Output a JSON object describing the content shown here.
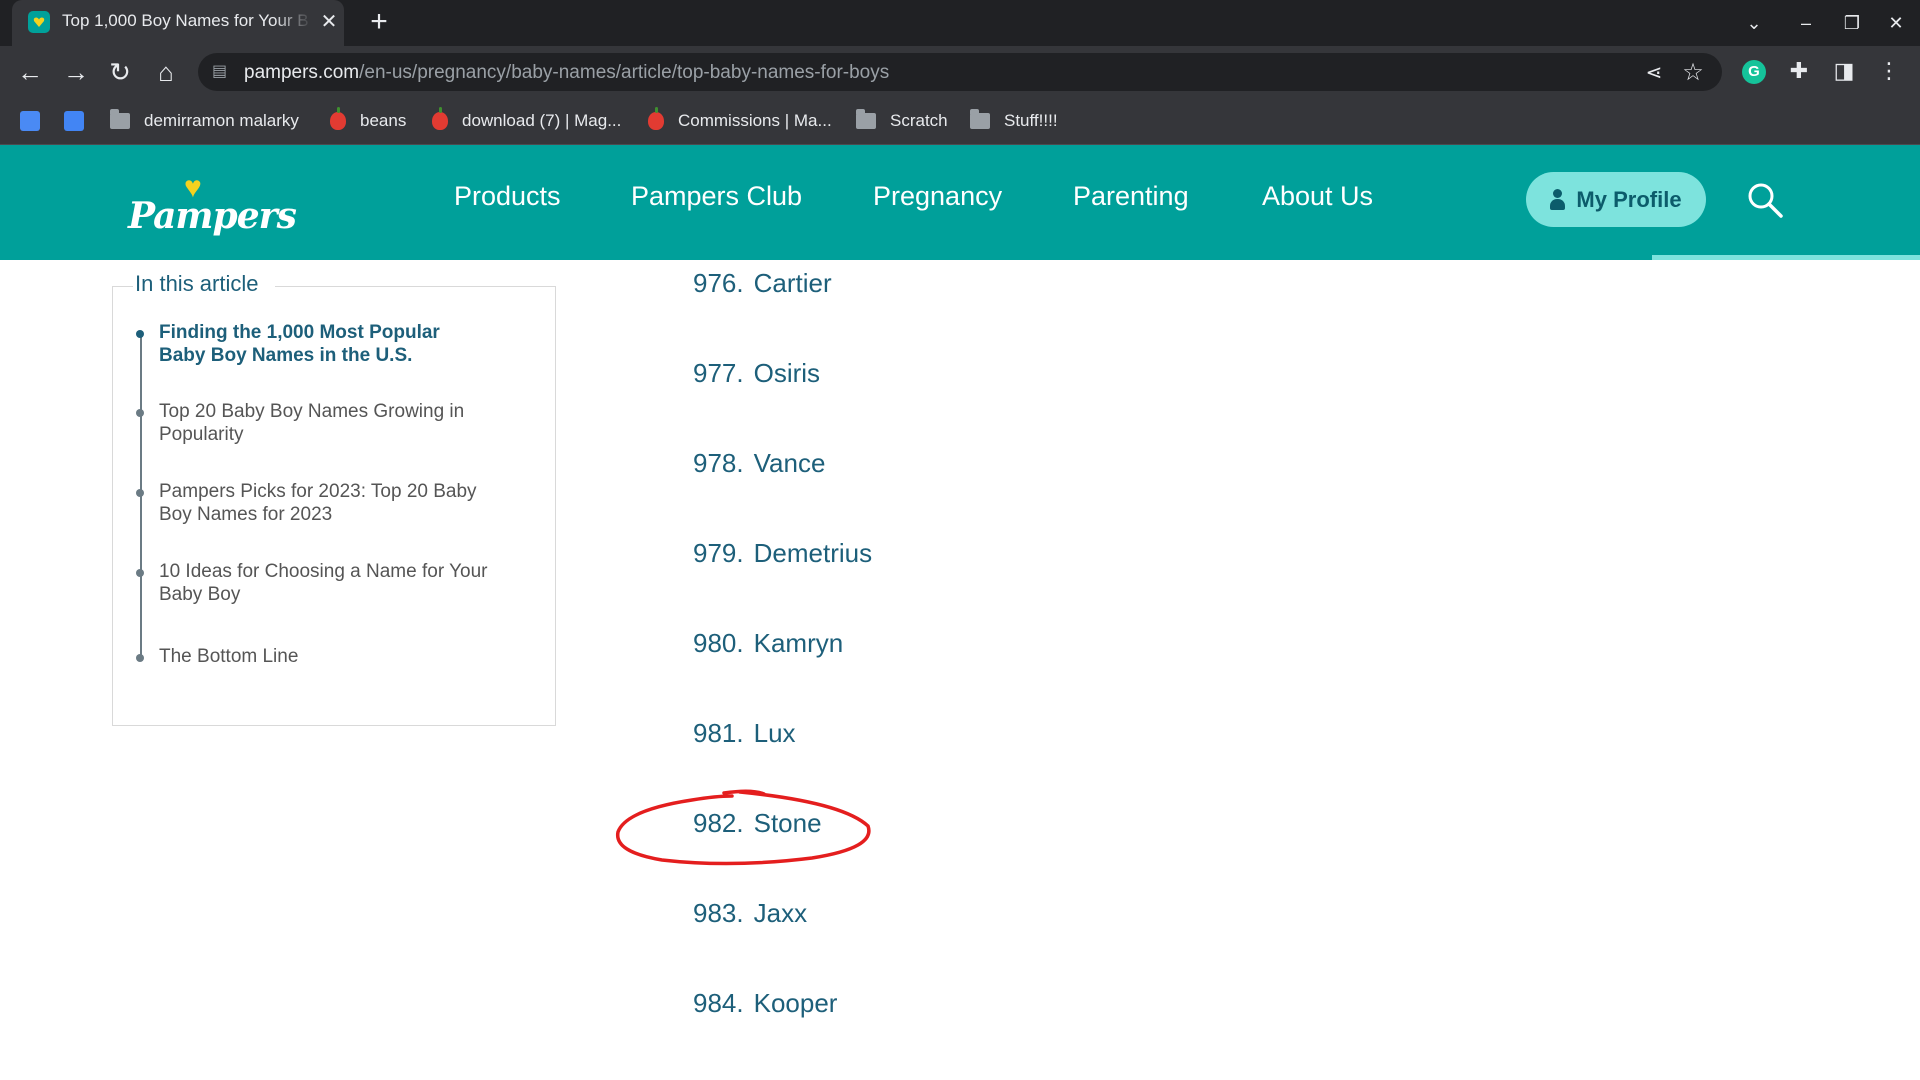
{
  "browser": {
    "tab_title": "Top 1,000 Boy Names for Your B",
    "url_host": "pampers.com",
    "url_path": "/en-us/pregnancy/baby-names/article/top-baby-names-for-boys",
    "bookmarks": [
      {
        "label": "",
        "icon": "translate-icon"
      },
      {
        "label": "",
        "icon": "docs-icon"
      },
      {
        "label": "demirramon malarky",
        "icon": "folder-icon"
      },
      {
        "label": "beans",
        "icon": "apple-icon"
      },
      {
        "label": "download (7) | Mag...",
        "icon": "apple-icon"
      },
      {
        "label": "Commissions | Ma...",
        "icon": "apple-icon"
      },
      {
        "label": "Scratch",
        "icon": "folder-icon"
      },
      {
        "label": "Stuff!!!!",
        "icon": "folder-icon"
      }
    ]
  },
  "site": {
    "logo": "Pampers",
    "nav": [
      "Products",
      "Pampers Club",
      "Pregnancy",
      "Parenting",
      "About Us"
    ],
    "profile_label": "My Profile",
    "accent": "#00a09a"
  },
  "toc": {
    "title": "In this article",
    "items": [
      "Finding the 1,000 Most Popular Baby Boy Names in the U.S.",
      "Top 20 Baby Boy Names Growing in Popularity",
      "Pampers Picks for 2023: Top 20 Baby Boy Names for 2023",
      "10 Ideas for Choosing a Name for Your Baby Boy",
      "The Bottom Line"
    ]
  },
  "names": [
    {
      "rank": "976.",
      "name": "Cartier"
    },
    {
      "rank": "977.",
      "name": "Osiris"
    },
    {
      "rank": "978.",
      "name": "Vance"
    },
    {
      "rank": "979.",
      "name": "Demetrius"
    },
    {
      "rank": "980.",
      "name": "Kamryn"
    },
    {
      "rank": "981.",
      "name": "Lux"
    },
    {
      "rank": "982.",
      "name": "Stone"
    },
    {
      "rank": "983.",
      "name": "Jaxx"
    },
    {
      "rank": "984.",
      "name": "Kooper"
    }
  ]
}
